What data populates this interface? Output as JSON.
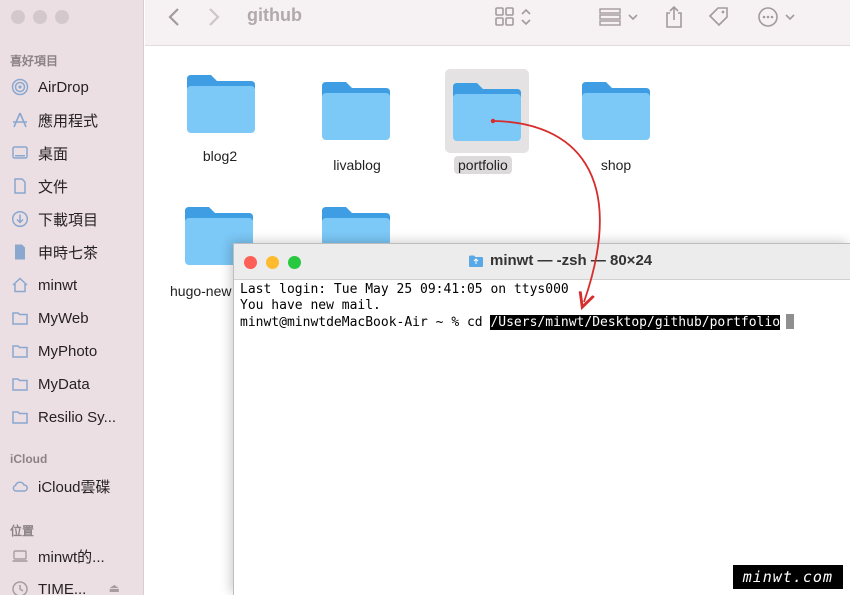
{
  "finder": {
    "window_title": "github",
    "sidebar": {
      "favorites_header": "喜好項目",
      "favorites": [
        {
          "label": "AirDrop",
          "icon": "airdrop-icon"
        },
        {
          "label": "應用程式",
          "icon": "applications-icon"
        },
        {
          "label": "桌面",
          "icon": "desktop-icon"
        },
        {
          "label": "文件",
          "icon": "document-icon"
        },
        {
          "label": "下載項目",
          "icon": "download-icon"
        },
        {
          "label": "申時七茶",
          "icon": "file-icon"
        },
        {
          "label": "minwt",
          "icon": "home-icon"
        },
        {
          "label": "MyWeb",
          "icon": "folder-icon"
        },
        {
          "label": "MyPhoto",
          "icon": "folder-icon"
        },
        {
          "label": "MyData",
          "icon": "folder-icon"
        },
        {
          "label": "Resilio Sy...",
          "icon": "folder-icon"
        }
      ],
      "icloud_header": "iCloud",
      "icloud": [
        {
          "label": "iCloud雲碟",
          "icon": "cloud-icon"
        }
      ],
      "locations_header": "位置",
      "locations": [
        {
          "label": "minwt的...",
          "icon": "laptop-icon"
        },
        {
          "label": "TIME...",
          "icon": "clock-icon"
        }
      ]
    },
    "folders": [
      {
        "name": "blog2"
      },
      {
        "name": "livablog"
      },
      {
        "name": "portfolio",
        "selected": true
      },
      {
        "name": "shop"
      },
      {
        "name": "hugo-new"
      },
      {
        "name": ""
      }
    ]
  },
  "terminal": {
    "title": "minwt — -zsh — 80×24",
    "lines": [
      "Last login: Tue May 25 09:41:05 on ttys000",
      "You have new mail."
    ],
    "prompt": "minwt@minwtdeMacBook-Air ~ % cd ",
    "command_arg": "/Users/minwt/Desktop/github/portfolio"
  },
  "watermark": "minwt.com",
  "colors": {
    "folder_light": "#7cc8f7",
    "folder_dark": "#3f9ee3",
    "arrow": "#d62d2d",
    "close": "#fe5f57",
    "minimize": "#febb2e",
    "zoom": "#28c840"
  }
}
